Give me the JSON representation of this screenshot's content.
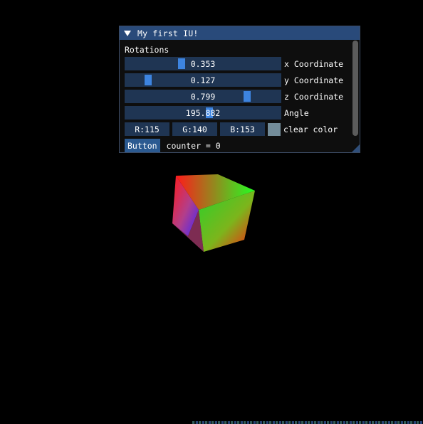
{
  "window": {
    "title": "My first IU!"
  },
  "rotations": {
    "section_label": "Rotations",
    "sliders": [
      {
        "value": "0.353",
        "label": "x Coordinate",
        "fraction": 0.353
      },
      {
        "value": "0.127",
        "label": "y Coordinate",
        "fraction": 0.127
      },
      {
        "value": "0.799",
        "label": "z Coordinate",
        "fraction": 0.799
      },
      {
        "value": "195.882",
        "label": "Angle",
        "fraction": 0.544
      }
    ]
  },
  "clear_color": {
    "r_text": "R:115",
    "g_text": "G:140",
    "b_text": "B:153",
    "swatch_color": "#738c99",
    "label": "clear color"
  },
  "button": {
    "label": "Button"
  },
  "counter": {
    "text": "counter = 0"
  },
  "colors": {
    "title_bg": "#294a7a",
    "frame_bg": "#1f3553",
    "grab": "#3d84e0",
    "button_bg": "#2b5a91"
  }
}
